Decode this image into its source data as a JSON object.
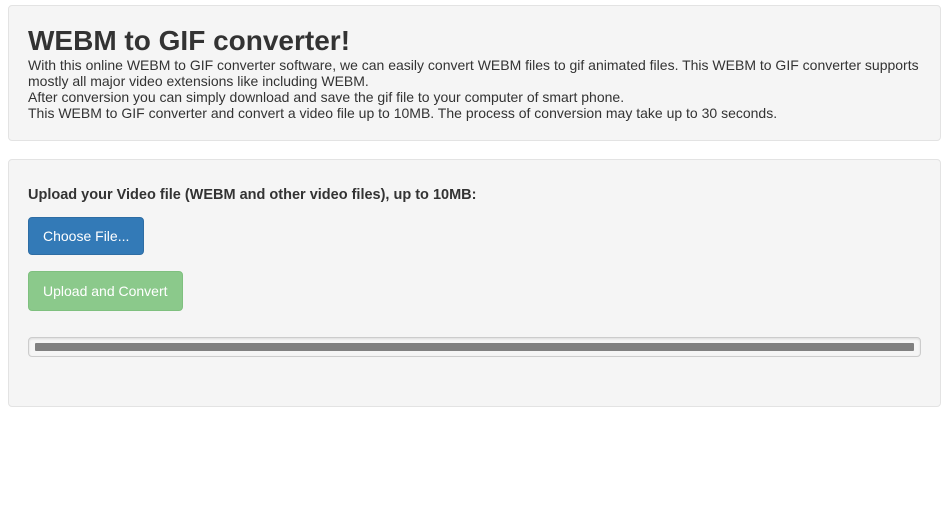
{
  "header": {
    "title": "WEBM to GIF converter!",
    "paragraphs": [
      "With this online WEBM to GIF converter software, we can easily convert WEBM files to gif animated files. This WEBM to GIF converter supports mostly all major video extensions like including WEBM.",
      "After conversion you can simply download and save the gif file to your computer of smart phone.",
      "This WEBM to GIF converter and convert a video file up to 10MB. The process of conversion may take up to 30 seconds."
    ]
  },
  "form": {
    "upload_label": "Upload your Video file (WEBM and other video files), up to 10MB:",
    "choose_file_label": "Choose File...",
    "upload_convert_label": "Upload and Convert",
    "progress_percent": 100
  }
}
